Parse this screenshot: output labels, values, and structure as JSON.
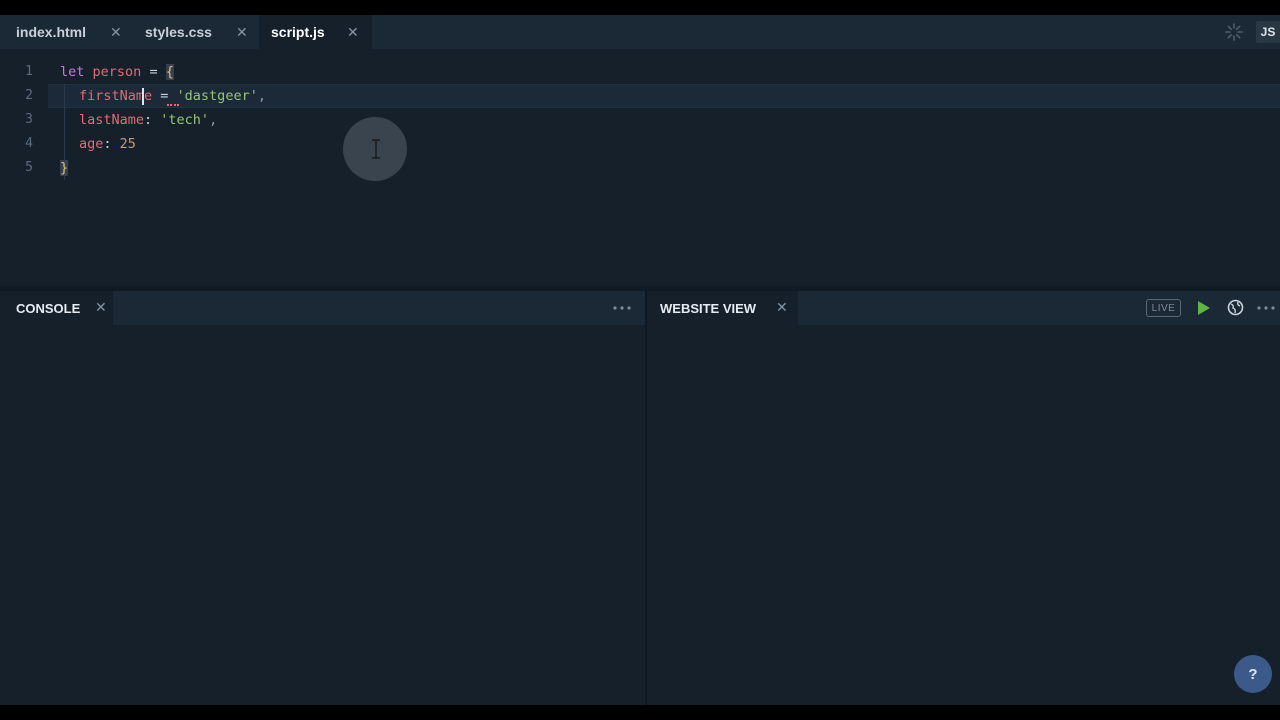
{
  "tabs": [
    {
      "label": "index.html",
      "close": "✕"
    },
    {
      "label": "styles.css",
      "close": "✕"
    },
    {
      "label": "script.js",
      "close": "✕"
    }
  ],
  "language_badge": "JS",
  "editor": {
    "line_numbers": [
      "1",
      "2",
      "3",
      "4",
      "5"
    ],
    "lines": [
      {
        "keyword": "let",
        "name": "person",
        "op": " = ",
        "brace": "{"
      },
      {
        "prop": "firstName",
        "op": " = ",
        "value": "'dastgeer'",
        "punct": ","
      },
      {
        "prop": "lastName",
        "op": ": ",
        "value": "'tech'",
        "punct": ","
      },
      {
        "prop": "age",
        "op": ": ",
        "value": "25"
      },
      {
        "brace": "}"
      }
    ]
  },
  "console": {
    "title": "CONSOLE",
    "close": "✕"
  },
  "website_view": {
    "title": "WEBSITE VIEW",
    "close": "✕",
    "live_label": "LIVE"
  },
  "help_label": "?",
  "colors": {
    "accent_play": "#5fb546",
    "help_button": "#3b5a8a",
    "background": "#15202b"
  }
}
